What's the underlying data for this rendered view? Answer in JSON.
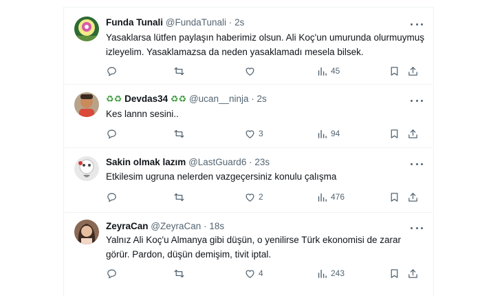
{
  "tweets": [
    {
      "name": "Funda Tunali",
      "handle": "@FundaTunali",
      "time": "2s",
      "text": "Yasaklarsa lütfen paylaşın haberimiz olsun. Ali Koç'un umurunda olurmuymuş izleyelim. Yasaklamazsa da neden yasaklamadı mesela bilsek.",
      "replies": "",
      "retweets": "",
      "likes": "",
      "views": "45"
    },
    {
      "name": "Devdas34",
      "name_emoji": "♻♻",
      "handle": "@ucan__ninja",
      "time": "2s",
      "text": "Kes lannn  sesini..",
      "replies": "",
      "retweets": "",
      "likes": "3",
      "views": "94"
    },
    {
      "name": "Sakin olmak lazım",
      "handle": "@LastGuard6",
      "time": "23s",
      "text": "Etkilesim ugruna nelerden vazgeçersiniz konulu çalışma",
      "replies": "",
      "retweets": "",
      "likes": "2",
      "views": "476"
    },
    {
      "name": "ZeyraCan",
      "handle": "@ZeyraCan",
      "time": "18s",
      "text": "Yalnız Ali Koç'u Almanya gibi düşün, o yenilirse Türk ekonomisi de zarar görür. Pardon, düşün demişim, tivit iptal.",
      "replies": "",
      "retweets": "",
      "likes": "4",
      "views": "243"
    }
  ],
  "separator": "·",
  "colors": {
    "text": "#0f1419",
    "secondary": "#536471",
    "border": "#eff3f4"
  }
}
